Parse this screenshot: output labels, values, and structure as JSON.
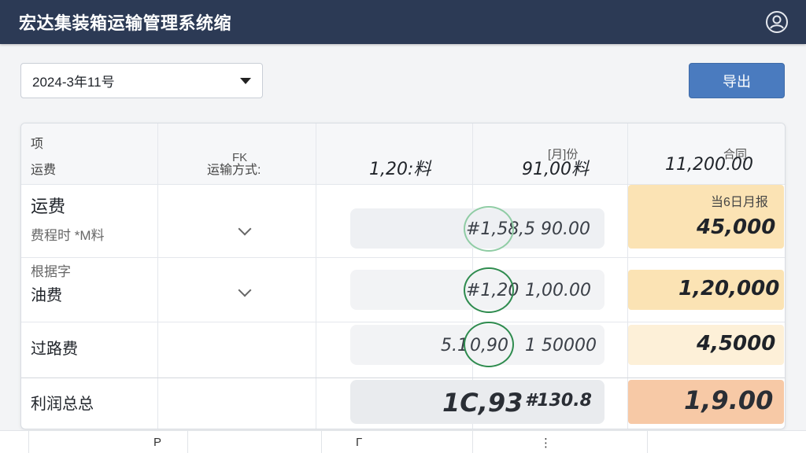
{
  "app": {
    "title": "宏达集装箱运输管理系统缩"
  },
  "toolbar": {
    "month_value": "2024-3年11号",
    "export_label": "导出"
  },
  "table": {
    "header": {
      "col1_top": "项",
      "col1_bottom": "运费",
      "col2_top": "FK",
      "col2_bottom": "运输方式:",
      "col3_value": "1,20:料",
      "col4_top": "[月]份",
      "col4_value": "91,00料",
      "col5_top": "合同",
      "col5_value": "11,200.00"
    },
    "rows": [
      {
        "label": "运费",
        "sub": "费程时 *M料",
        "circled": "#1,58",
        "value": ",5 90.00",
        "box_caption": "当6日月报",
        "box_value": "45,000"
      },
      {
        "above": "根据字",
        "label": "油费",
        "circled": "#1,20",
        "value": "1,00.00",
        "box_value": "1,20,000"
      },
      {
        "label": "过路费",
        "prefix": "5.1",
        "circled": "0,90",
        "value": "1 50000",
        "box_value": "4,5000"
      }
    ],
    "total": {
      "label": "利润总总",
      "value_a": "1C,93",
      "value_b": "#130.8",
      "box_value": "1,9.00"
    }
  },
  "footer": {
    "cells": [
      "P",
      "Γ",
      "⋮"
    ]
  },
  "colors": {
    "titlebar": "#2c3a55",
    "export": "#4a7bbf",
    "ring": "#2e8b4e",
    "box_light": "#fdf0d8",
    "box_mid": "#fbe3b4",
    "box_total": "#f7c9a6"
  }
}
